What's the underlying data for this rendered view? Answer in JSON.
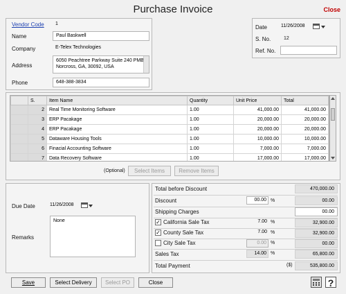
{
  "window": {
    "title": "Purchase Invoice",
    "close_label": "Close"
  },
  "vendor": {
    "code_label": "Vendor Code",
    "code": "1",
    "name_label": "Name",
    "name": "Paul Baskwell",
    "company_label": "Company",
    "company": "E-Telex Technologies",
    "address_label": "Address",
    "address_line1": "6050 Peachtree Parkway Suite 240 PMB,",
    "address_line2": "Norcross, GA, 30092, USA",
    "phone_label": "Phone",
    "phone": "648-388-3834"
  },
  "invoice": {
    "date_label": "Date",
    "date": "11/26/2008",
    "sno_label": "S. No.",
    "sno": "12",
    "refno_label": "Ref. No.",
    "refno": ""
  },
  "items_table": {
    "headers": [
      "S.",
      "Item Name",
      "Quantity",
      "Unit Price",
      "Total"
    ],
    "rows": [
      [
        "2",
        "Real Time Monitoring Software",
        "1.00",
        "41,000.00",
        "41,000.00"
      ],
      [
        "3",
        "ERP Pacakage",
        "1.00",
        "20,000.00",
        "20,000.00"
      ],
      [
        "4",
        "ERP Pacakage",
        "1.00",
        "20,000.00",
        "20,000.00"
      ],
      [
        "5",
        "Dataware Housing Tools",
        "1.00",
        "10,000.00",
        "10,000.00"
      ],
      [
        "6",
        "Finacial Accounting Software",
        "1.00",
        "7,000.00",
        "7,000.00"
      ],
      [
        "7",
        "Data Recovery Software",
        "1.00",
        "17,000.00",
        "17,000.00"
      ]
    ],
    "optional_label": "(Optional)",
    "select_items_label": "Select Items",
    "remove_items_label": "Remove Items"
  },
  "due": {
    "due_date_label": "Due Date",
    "due_date": "11/26/2008",
    "remarks_label": "Remarks",
    "remarks": "None"
  },
  "totals": {
    "total_before_discount_label": "Total before Discount",
    "total_before_discount": "470,000.00",
    "discount_label": "Discount",
    "discount_pct": "00.00",
    "discount_amount": "00.00",
    "shipping_label": "Shipping Charges",
    "shipping": "00.00",
    "ca_label": "California Sale Tax",
    "ca_checked": true,
    "ca_pct": "7.00",
    "ca_amount": "32,900.00",
    "county_label": "County Sale Tax",
    "county_checked": true,
    "county_pct": "7.00",
    "county_amount": "32,900.00",
    "city_label": "City Sale Tax",
    "city_checked": false,
    "city_pct": "0.00",
    "city_amount": "00.00",
    "sales_tax_label": "Sales Tax",
    "sales_tax_pct": "14.00",
    "sales_tax_amount": "65,800.00",
    "total_payment_label": "Total Payment",
    "currency": "($)",
    "total_payment": "535,800.00",
    "pct_symbol": "%",
    "check_mark": "✓"
  },
  "footer": {
    "save_label": "Save",
    "select_delivery_label": "Select Delivery",
    "select_po_label": "Select PO",
    "close_label": "Close",
    "help_label": "?"
  }
}
